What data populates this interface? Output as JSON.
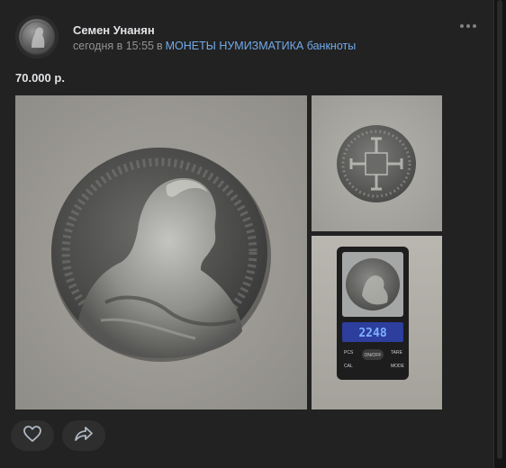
{
  "post": {
    "author": "Семен Унанян",
    "time": "сегодня в 15:55",
    "in_word": "в",
    "group": "МОНЕТЫ НУМИЗМАТИКА банкноты",
    "text": "70.000 р."
  },
  "scale_display": "2248",
  "scale_buttons": [
    "PCS",
    "TARE",
    "ON/OFF",
    "CAL",
    "MODE"
  ],
  "icons": {
    "more": "more-dots-icon",
    "like": "heart-icon",
    "share": "share-arrow-icon"
  },
  "colors": {
    "background": "#222222",
    "link": "#71aaeb",
    "secondary_text": "#939393"
  }
}
